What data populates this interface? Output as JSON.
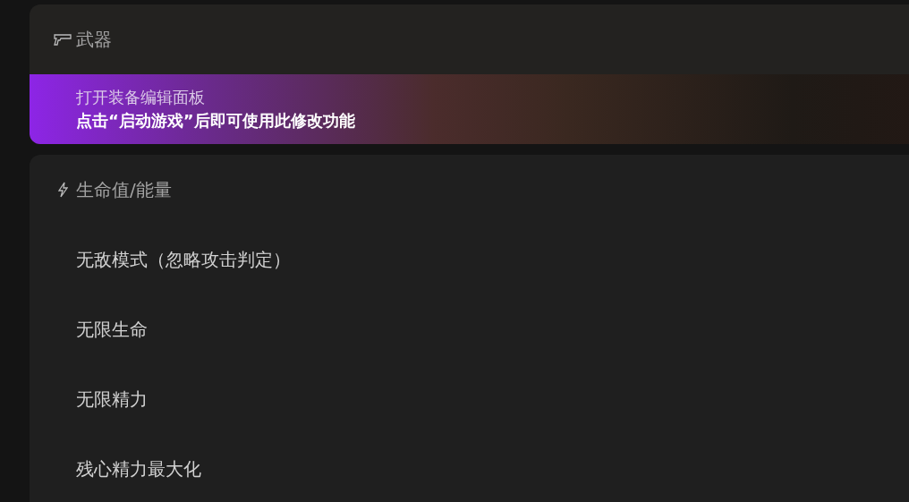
{
  "sections": [
    {
      "title": "武器",
      "kind": "weapon",
      "banner": {
        "title": "打开装备编辑面板",
        "subtitle": "点击“启动游戏”后即可使用此修改功能"
      }
    },
    {
      "title": "生命值/能量",
      "kind": "vitals",
      "items": [
        "无敌模式（忽略攻击判定）",
        "无限生命",
        "无限精力",
        "残心精力最大化"
      ]
    }
  ]
}
